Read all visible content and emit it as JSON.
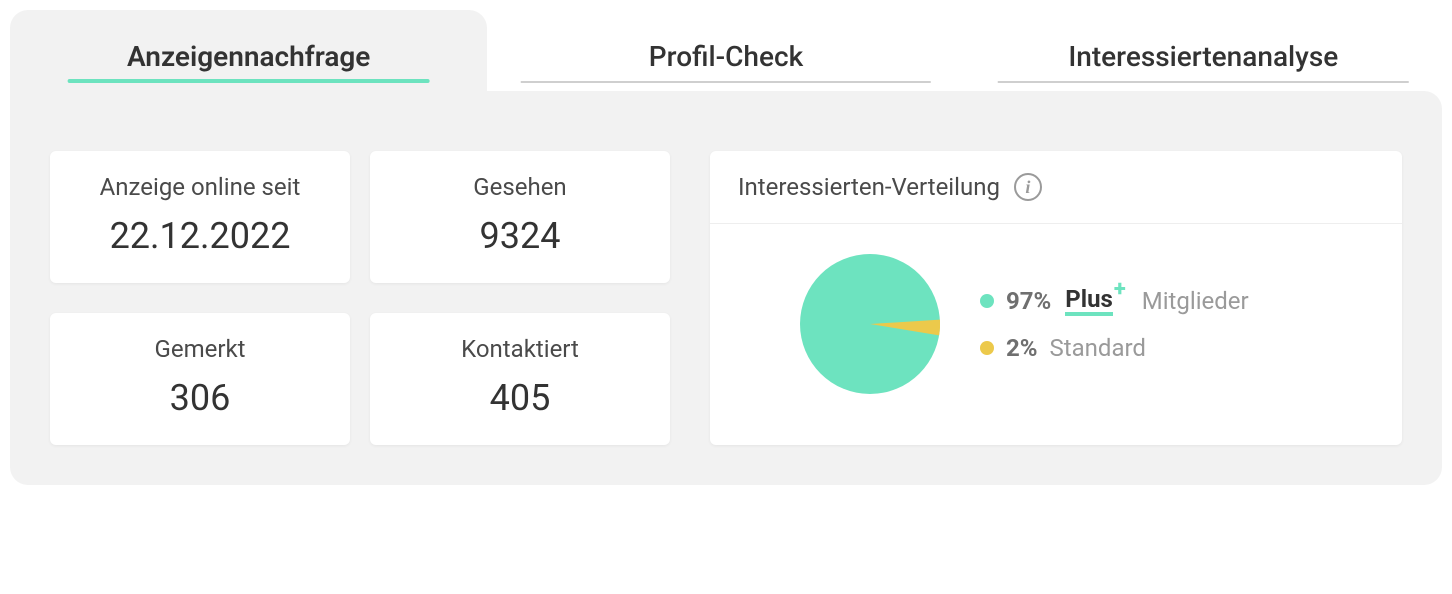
{
  "tabs": [
    {
      "label": "Anzeigennachfrage",
      "active": true
    },
    {
      "label": "Profil-Check",
      "active": false
    },
    {
      "label": "Interessiertenanalyse",
      "active": false
    }
  ],
  "stats": {
    "online_since": {
      "label": "Anzeige online seit",
      "value": "22.12.2022"
    },
    "seen": {
      "label": "Gesehen",
      "value": "9324"
    },
    "saved": {
      "label": "Gemerkt",
      "value": "306"
    },
    "contacted": {
      "label": "Kontaktiert",
      "value": "405"
    }
  },
  "distribution": {
    "title": "Interessierten-Verteilung",
    "plus": {
      "percent": "97%",
      "badge_text": "Plus",
      "suffix": "Mitglieder",
      "color": "#6de3bf"
    },
    "standard": {
      "percent": "2%",
      "label": "Standard",
      "color": "#ecc94b"
    }
  },
  "chart_data": {
    "type": "pie",
    "title": "Interessierten-Verteilung",
    "series": [
      {
        "name": "Plus Mitglieder",
        "value": 97,
        "color": "#6de3bf"
      },
      {
        "name": "Standard",
        "value": 2,
        "color": "#ecc94b"
      }
    ]
  }
}
